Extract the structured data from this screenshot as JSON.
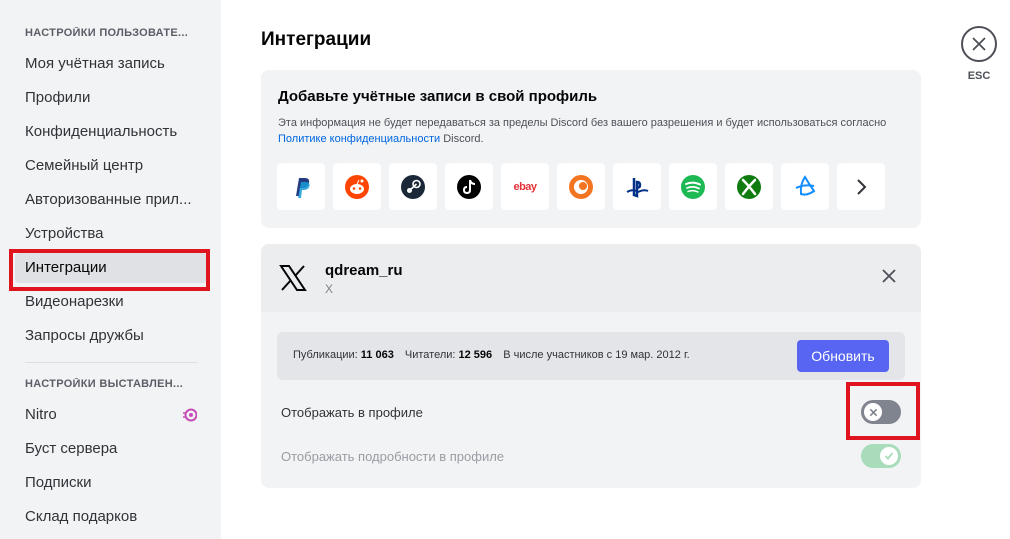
{
  "sidebar": {
    "header_user": "НАСТРОЙКИ ПОЛЬЗОВАТЕ...",
    "header_app": "НАСТРОЙКИ ВЫСТАВЛЕН...",
    "items": [
      {
        "label": "Моя учётная запись"
      },
      {
        "label": "Профили"
      },
      {
        "label": "Конфиденциальность"
      },
      {
        "label": "Семейный центр"
      },
      {
        "label": "Авторизованные прил..."
      },
      {
        "label": "Устройства"
      },
      {
        "label": "Интеграции",
        "active": true
      },
      {
        "label": "Видеонарезки"
      },
      {
        "label": "Запросы дружбы"
      }
    ],
    "billing_items": [
      {
        "label": "Nitro",
        "icon": "nitro-icon"
      },
      {
        "label": "Буст сервера"
      },
      {
        "label": "Подписки"
      },
      {
        "label": "Склад подарков"
      }
    ]
  },
  "main": {
    "title": "Интеграции",
    "add_card": {
      "title": "Добавьте учётные записи в свой профиль",
      "info_prefix": "Эта информация не будет передаваться за пределы Discord без вашего разрешения и будет использоваться согласно",
      "info_link": "Политике конфиденциальности",
      "info_suffix": "Discord.",
      "services": [
        "paypal-icon",
        "reddit-icon",
        "steam-icon",
        "tiktok-icon",
        "ebay-icon",
        "crunchyroll-icon",
        "playstation-icon",
        "spotify-icon",
        "xbox-icon",
        "battlenet-icon",
        "chevron-right-icon"
      ],
      "ebay_text": "ebay"
    },
    "connection": {
      "name": "qdream_ru",
      "service": "X",
      "stats": {
        "posts_label": "Публикации:",
        "posts_value": "11 063",
        "followers_label": "Читатели:",
        "followers_value": "12 596",
        "member_since": "В числе участников с 19 мар. 2012 г."
      },
      "update_label": "Обновить",
      "show_on_profile_label": "Отображать в профиле",
      "show_on_profile_on": false,
      "show_details_label": "Отображать подробности в профиле",
      "show_details_on": true
    }
  },
  "close": {
    "label": "ESC"
  },
  "colors": {
    "accent": "#5865f2",
    "highlight": "#e0141e",
    "toggle_on": "#a8dcbb",
    "toggle_off": "#80848e",
    "link": "#0067e0"
  }
}
